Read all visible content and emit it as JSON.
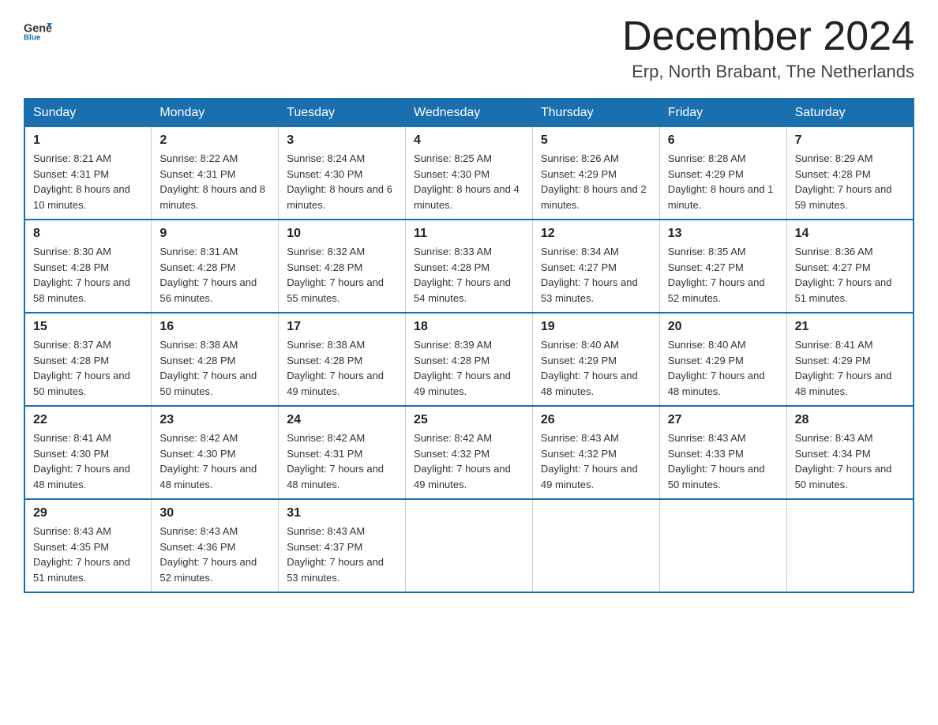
{
  "header": {
    "logo_general": "General",
    "logo_blue": "Blue",
    "month_title": "December 2024",
    "location": "Erp, North Brabant, The Netherlands"
  },
  "weekdays": [
    "Sunday",
    "Monday",
    "Tuesday",
    "Wednesday",
    "Thursday",
    "Friday",
    "Saturday"
  ],
  "weeks": [
    [
      {
        "day": "1",
        "sunrise": "8:21 AM",
        "sunset": "4:31 PM",
        "daylight": "8 hours and 10 minutes."
      },
      {
        "day": "2",
        "sunrise": "8:22 AM",
        "sunset": "4:31 PM",
        "daylight": "8 hours and 8 minutes."
      },
      {
        "day": "3",
        "sunrise": "8:24 AM",
        "sunset": "4:30 PM",
        "daylight": "8 hours and 6 minutes."
      },
      {
        "day": "4",
        "sunrise": "8:25 AM",
        "sunset": "4:30 PM",
        "daylight": "8 hours and 4 minutes."
      },
      {
        "day": "5",
        "sunrise": "8:26 AM",
        "sunset": "4:29 PM",
        "daylight": "8 hours and 2 minutes."
      },
      {
        "day": "6",
        "sunrise": "8:28 AM",
        "sunset": "4:29 PM",
        "daylight": "8 hours and 1 minute."
      },
      {
        "day": "7",
        "sunrise": "8:29 AM",
        "sunset": "4:28 PM",
        "daylight": "7 hours and 59 minutes."
      }
    ],
    [
      {
        "day": "8",
        "sunrise": "8:30 AM",
        "sunset": "4:28 PM",
        "daylight": "7 hours and 58 minutes."
      },
      {
        "day": "9",
        "sunrise": "8:31 AM",
        "sunset": "4:28 PM",
        "daylight": "7 hours and 56 minutes."
      },
      {
        "day": "10",
        "sunrise": "8:32 AM",
        "sunset": "4:28 PM",
        "daylight": "7 hours and 55 minutes."
      },
      {
        "day": "11",
        "sunrise": "8:33 AM",
        "sunset": "4:28 PM",
        "daylight": "7 hours and 54 minutes."
      },
      {
        "day": "12",
        "sunrise": "8:34 AM",
        "sunset": "4:27 PM",
        "daylight": "7 hours and 53 minutes."
      },
      {
        "day": "13",
        "sunrise": "8:35 AM",
        "sunset": "4:27 PM",
        "daylight": "7 hours and 52 minutes."
      },
      {
        "day": "14",
        "sunrise": "8:36 AM",
        "sunset": "4:27 PM",
        "daylight": "7 hours and 51 minutes."
      }
    ],
    [
      {
        "day": "15",
        "sunrise": "8:37 AM",
        "sunset": "4:28 PM",
        "daylight": "7 hours and 50 minutes."
      },
      {
        "day": "16",
        "sunrise": "8:38 AM",
        "sunset": "4:28 PM",
        "daylight": "7 hours and 50 minutes."
      },
      {
        "day": "17",
        "sunrise": "8:38 AM",
        "sunset": "4:28 PM",
        "daylight": "7 hours and 49 minutes."
      },
      {
        "day": "18",
        "sunrise": "8:39 AM",
        "sunset": "4:28 PM",
        "daylight": "7 hours and 49 minutes."
      },
      {
        "day": "19",
        "sunrise": "8:40 AM",
        "sunset": "4:29 PM",
        "daylight": "7 hours and 48 minutes."
      },
      {
        "day": "20",
        "sunrise": "8:40 AM",
        "sunset": "4:29 PM",
        "daylight": "7 hours and 48 minutes."
      },
      {
        "day": "21",
        "sunrise": "8:41 AM",
        "sunset": "4:29 PM",
        "daylight": "7 hours and 48 minutes."
      }
    ],
    [
      {
        "day": "22",
        "sunrise": "8:41 AM",
        "sunset": "4:30 PM",
        "daylight": "7 hours and 48 minutes."
      },
      {
        "day": "23",
        "sunrise": "8:42 AM",
        "sunset": "4:30 PM",
        "daylight": "7 hours and 48 minutes."
      },
      {
        "day": "24",
        "sunrise": "8:42 AM",
        "sunset": "4:31 PM",
        "daylight": "7 hours and 48 minutes."
      },
      {
        "day": "25",
        "sunrise": "8:42 AM",
        "sunset": "4:32 PM",
        "daylight": "7 hours and 49 minutes."
      },
      {
        "day": "26",
        "sunrise": "8:43 AM",
        "sunset": "4:32 PM",
        "daylight": "7 hours and 49 minutes."
      },
      {
        "day": "27",
        "sunrise": "8:43 AM",
        "sunset": "4:33 PM",
        "daylight": "7 hours and 50 minutes."
      },
      {
        "day": "28",
        "sunrise": "8:43 AM",
        "sunset": "4:34 PM",
        "daylight": "7 hours and 50 minutes."
      }
    ],
    [
      {
        "day": "29",
        "sunrise": "8:43 AM",
        "sunset": "4:35 PM",
        "daylight": "7 hours and 51 minutes."
      },
      {
        "day": "30",
        "sunrise": "8:43 AM",
        "sunset": "4:36 PM",
        "daylight": "7 hours and 52 minutes."
      },
      {
        "day": "31",
        "sunrise": "8:43 AM",
        "sunset": "4:37 PM",
        "daylight": "7 hours and 53 minutes."
      },
      null,
      null,
      null,
      null
    ]
  ]
}
